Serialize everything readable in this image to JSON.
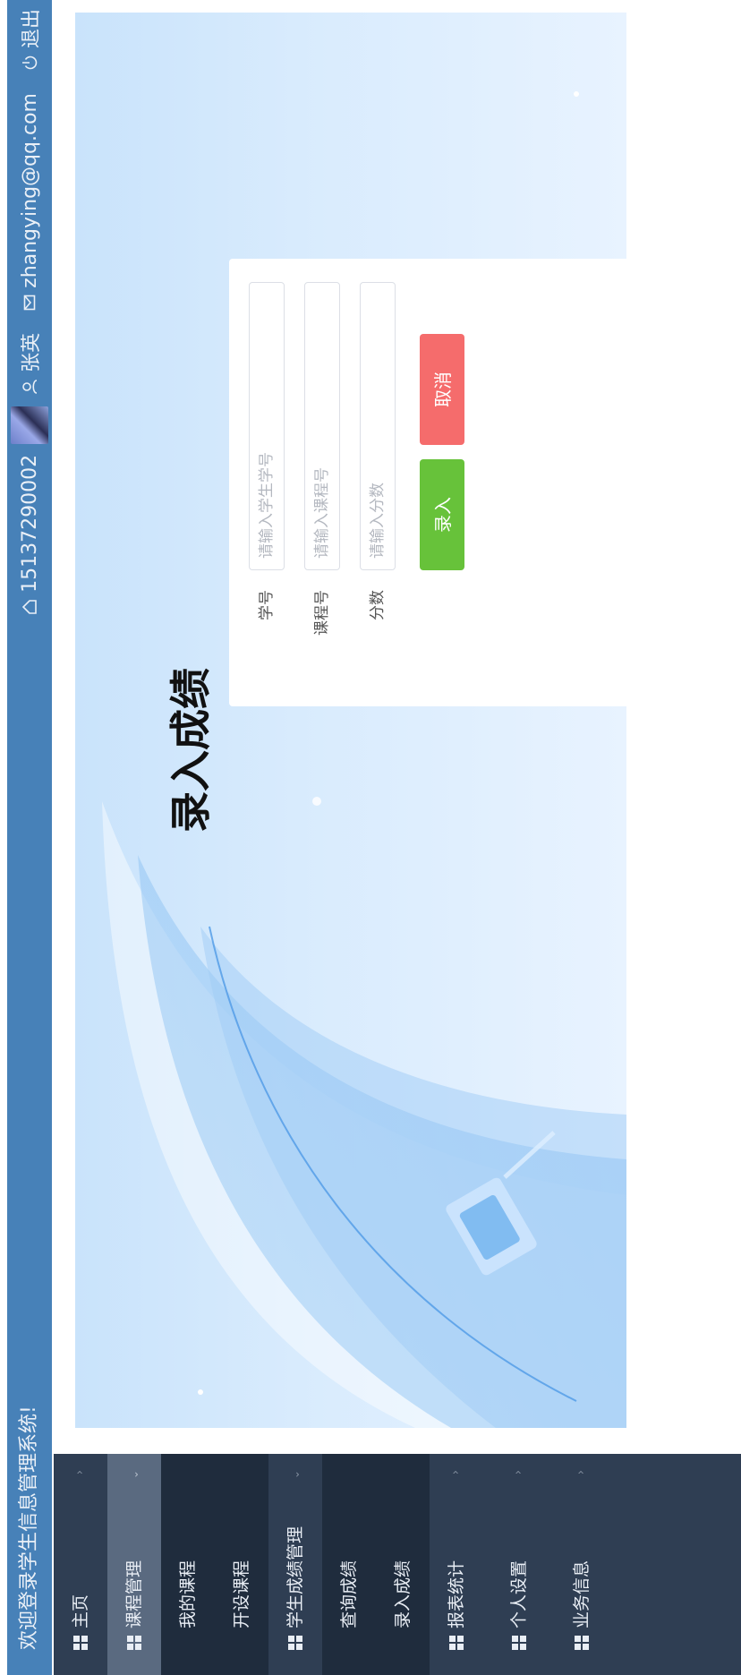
{
  "header": {
    "welcome": "欢迎登录学生信息管理系统!",
    "phone": "15137290002",
    "username": "张英",
    "email": "zhangying@qq.com",
    "logout": "退出"
  },
  "sidebar": {
    "items": [
      {
        "label": "主页",
        "kind": "parent"
      },
      {
        "label": "课程管理",
        "kind": "parent",
        "expanded": true
      },
      {
        "label": "我的课程",
        "kind": "child"
      },
      {
        "label": "开设课程",
        "kind": "child"
      },
      {
        "label": "学生成绩管理",
        "kind": "parent",
        "expanded": true
      },
      {
        "label": "查询成绩",
        "kind": "child"
      },
      {
        "label": "录入成绩",
        "kind": "child"
      },
      {
        "label": "报表统计",
        "kind": "parent"
      },
      {
        "label": "个人设置",
        "kind": "parent"
      },
      {
        "label": "业务信息",
        "kind": "parent"
      }
    ]
  },
  "page": {
    "title": "录入成绩"
  },
  "form": {
    "student_id": {
      "label": "学号",
      "placeholder": "请输入学生学号",
      "value": ""
    },
    "course_id": {
      "label": "课程号",
      "placeholder": "请输入课程号",
      "value": ""
    },
    "score": {
      "label": "分数",
      "placeholder": "请输入分数",
      "value": ""
    },
    "submit_label": "录入",
    "cancel_label": "取消"
  },
  "colors": {
    "header_bg": "#4781b8",
    "sidebar_bg": "#2f3e53",
    "submit_button": "#67c23a",
    "cancel_button": "#f56c6c"
  }
}
